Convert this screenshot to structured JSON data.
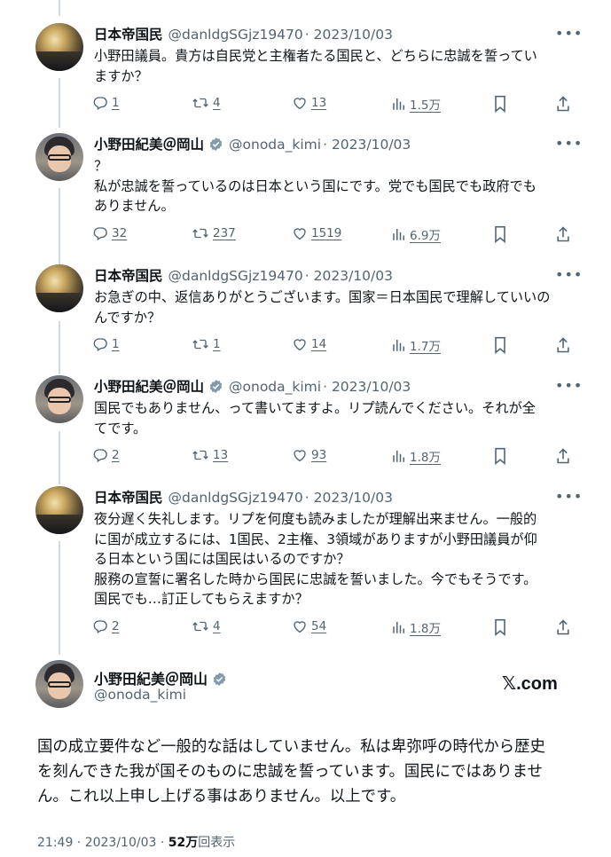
{
  "tweets": [
    {
      "name": "日本帝国民",
      "handle": "@danldgSGjz19470",
      "date": "· 2023/10/03",
      "verified": false,
      "text_lines": [
        "小野田議員。貴方は自民党と主権者たる国民と、どちらに忠誠を誓ってい",
        "ますか？"
      ],
      "replies": "1",
      "retweets": "4",
      "likes": "13",
      "views": "1.5万"
    },
    {
      "name": "小野田紀美＠岡山",
      "handle": "@onoda_kimi",
      "date": "· 2023/10/03",
      "verified": true,
      "text_lines": [
        "？",
        "私が忠誠を誓っているのは日本という国にです。党でも国民でも政府でも",
        "ありません。"
      ],
      "replies": "32",
      "retweets": "237",
      "likes": "1519",
      "views": "6.9万"
    },
    {
      "name": "日本帝国民",
      "handle": "@danldgSGjz19470",
      "date": "· 2023/10/03",
      "verified": false,
      "text_lines": [
        "お急ぎの中、返信ありがとうございます。国家＝日本国民で理解していいの",
        "んですか？"
      ],
      "replies": "1",
      "retweets": "1",
      "likes": "14",
      "views": "1.7万"
    },
    {
      "name": "小野田紀美＠岡山",
      "handle": "@onoda_kimi",
      "date": "· 2023/10/03",
      "verified": true,
      "text_lines": [
        "国民でもありません、って書いてますよ。リプ読んでください。それが全",
        "てです。"
      ],
      "replies": "2",
      "retweets": "13",
      "likes": "93",
      "views": "1.8万"
    },
    {
      "name": "日本帝国民",
      "handle": "@danldgSGjz19470",
      "date": "· 2023/10/03",
      "verified": false,
      "text_lines": [
        "夜分遅く失礼します。リプを何度も読みましたが理解出来ません。一般的",
        "に国が成立するには、1国民、2主権、3領域がありますが小野田議員が仰",
        "る日本という国には国民はいるのですか？",
        "服務の宣誓に署名した時から国民に忠誠を誓いました。今でもそうです。",
        "国民でも…訂正してもらえますか？"
      ],
      "replies": "2",
      "retweets": "4",
      "likes": "54",
      "views": "1.8万"
    }
  ],
  "main_tweet": {
    "name": "小野田紀美＠岡山",
    "handle": "@onoda_kimi",
    "brand": "𝕏.com",
    "text_lines": [
      "国の成立要件など一般的な話はしていません。私は卑弥呼の時代から歴史",
      "を刻んできた我が国そのものに忠誠を誓っています。国民にではありませ",
      "ん。これ以上申し上げる事はありません。以上です。"
    ],
    "time": "21:49 · 2023/10/03 · ",
    "views_count": "52万",
    "views_label": "回表示"
  },
  "colors": {
    "text": "#0f1419",
    "secondary": "#536471",
    "verified": "#829aab",
    "thread_line": "#cfd9de"
  },
  "icons": [
    "reply-icon",
    "retweet-icon",
    "like-icon",
    "views-icon",
    "bookmark-icon",
    "share-icon",
    "verified-icon",
    "more-icon"
  ]
}
